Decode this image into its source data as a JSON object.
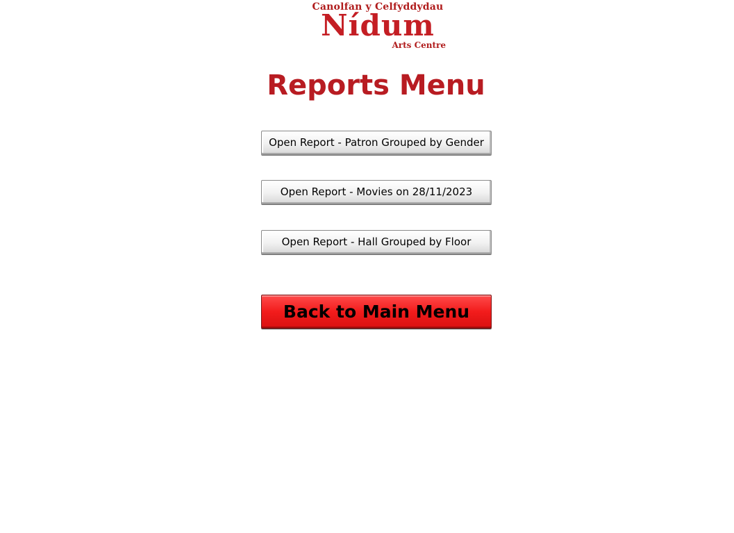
{
  "logo": {
    "top_line": "Canolfan y Celfyddydau",
    "name": "Nídum",
    "subtitle": "Arts Centre"
  },
  "page_title": "Reports Menu",
  "buttons": [
    {
      "label": "Open Report - Patron Grouped by Gender"
    },
    {
      "label": "Open Report - Movies on 28/11/2023"
    },
    {
      "label": "Open Report - Hall Grouped by Floor"
    }
  ],
  "back_button": {
    "label": "Back to Main Menu"
  },
  "colors": {
    "brand_red": "#c41e24",
    "title_red": "#b81c22",
    "back_button_red": "#f21c1c"
  }
}
